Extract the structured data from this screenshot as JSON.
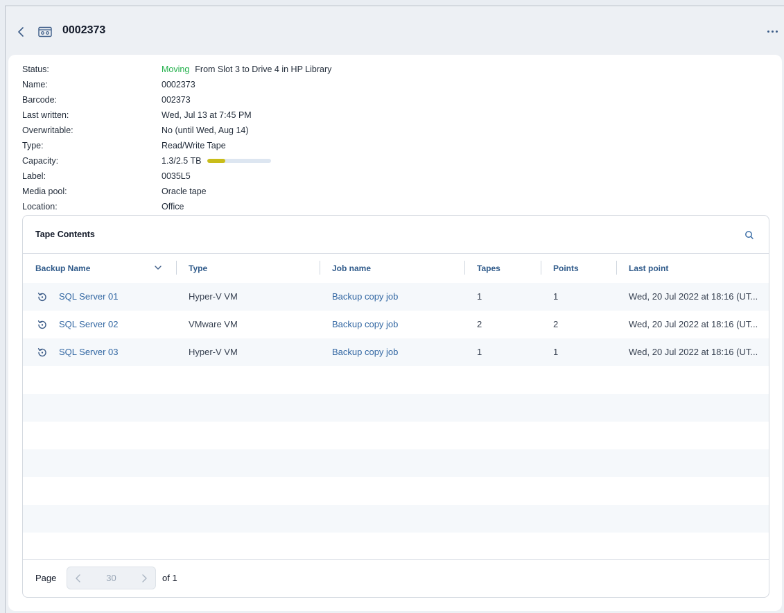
{
  "header": {
    "title": "0002373"
  },
  "properties": [
    {
      "label": "Status:",
      "value": "From Slot 3 to Drive 4 in HP Library",
      "status": "Moving"
    },
    {
      "label": "Name:",
      "value": "0002373"
    },
    {
      "label": "Barcode:",
      "value": "002373"
    },
    {
      "label": "Last written:",
      "value": "Wed, Jul 13 at 7:45 PM"
    },
    {
      "label": "Overwritable:",
      "value": "No (until Wed, Aug 14)"
    },
    {
      "label": "Type:",
      "value": "Read/Write Tape"
    },
    {
      "label": "Capacity:",
      "value": "1.3/2.5 TB",
      "fraction": 0.28
    },
    {
      "label": "Label:",
      "value": "0035L5"
    },
    {
      "label": "Media pool:",
      "value": "Oracle tape"
    },
    {
      "label": "Location:",
      "value": "Office"
    }
  ],
  "tape_contents": {
    "title": "Tape Contents",
    "columns": [
      "Backup Name",
      "Type",
      "Job name",
      "Tapes",
      "Points",
      "Last point"
    ],
    "rows": [
      {
        "name": "SQL Server 01",
        "type": "Hyper-V VM",
        "job": "Backup copy job",
        "tapes": "1",
        "points": "1",
        "last_point": "Wed, 20 Jul 2022 at 18:16 (UT..."
      },
      {
        "name": "SQL Server 02",
        "type": "VMware VM",
        "job": "Backup copy job",
        "tapes": "2",
        "points": "2",
        "last_point": "Wed, 20 Jul 2022 at 18:16 (UT..."
      },
      {
        "name": "SQL Server 03",
        "type": "Hyper-V VM",
        "job": "Backup copy job",
        "tapes": "1",
        "points": "1",
        "last_point": "Wed, 20 Jul 2022 at 18:16 (UT..."
      }
    ]
  },
  "pagination": {
    "label": "Page",
    "current": "30",
    "total_text": "of 1"
  },
  "colors": {
    "status_moving": "#22b04b",
    "link": "#3166a2",
    "capacity_fill": "#c9bd1a"
  },
  "icons": {
    "back": "chevron-left-icon",
    "tape": "tape-cassette-icon",
    "more": "more-dots-icon",
    "search": "search-icon",
    "row": "restore-icon",
    "sort": "chevron-down-icon"
  }
}
